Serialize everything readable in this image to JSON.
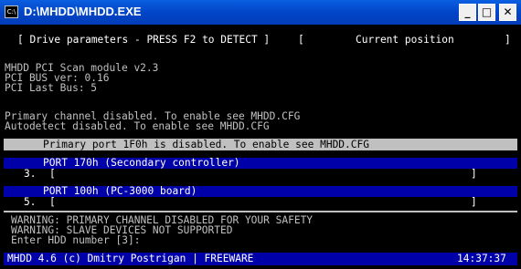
{
  "window": {
    "title": "D:\\MHDD\\MHDD.EXE",
    "icon_name": "console-icon",
    "icon_text": "C:\\",
    "minimize": "_",
    "maximize": "□",
    "close": "✕"
  },
  "header": {
    "left": "[ Drive parameters - PRESS F2 to DETECT ]",
    "right_open": "[",
    "right": "Current position",
    "right_close": "]"
  },
  "info": {
    "line1": "MHDD PCI Scan module v2.3",
    "line2": "PCI BUS ver: 0.16",
    "line3": "PCI Last Bus: 5",
    "line4": "Primary channel disabled. To enable see MHDD.CFG",
    "line5": "Autodetect disabled. To enable see MHDD.CFG"
  },
  "ports": {
    "primary": "Primary port 1F0h is disabled. To enable see MHDD.CFG",
    "p170": "PORT 170h (Secondary controller)",
    "slot3": "3.",
    "slot3_open": "[",
    "slot3_close": "]",
    "p100": "PORT 100h (PC-3000 board)",
    "slot5": "5.",
    "slot5_open": "[",
    "slot5_close": "]"
  },
  "messages": {
    "warn1": "WARNING: PRIMARY CHANNEL DISABLED FOR YOUR SAFETY",
    "warn2": "WARNING: SLAVE DEVICES NOT SUPPORTED",
    "prompt": "Enter HDD number [3]:"
  },
  "status": {
    "left": "MHDD 4.6 (c) Dmitry Postrigan | FREEWARE",
    "right": "14:37:37"
  }
}
